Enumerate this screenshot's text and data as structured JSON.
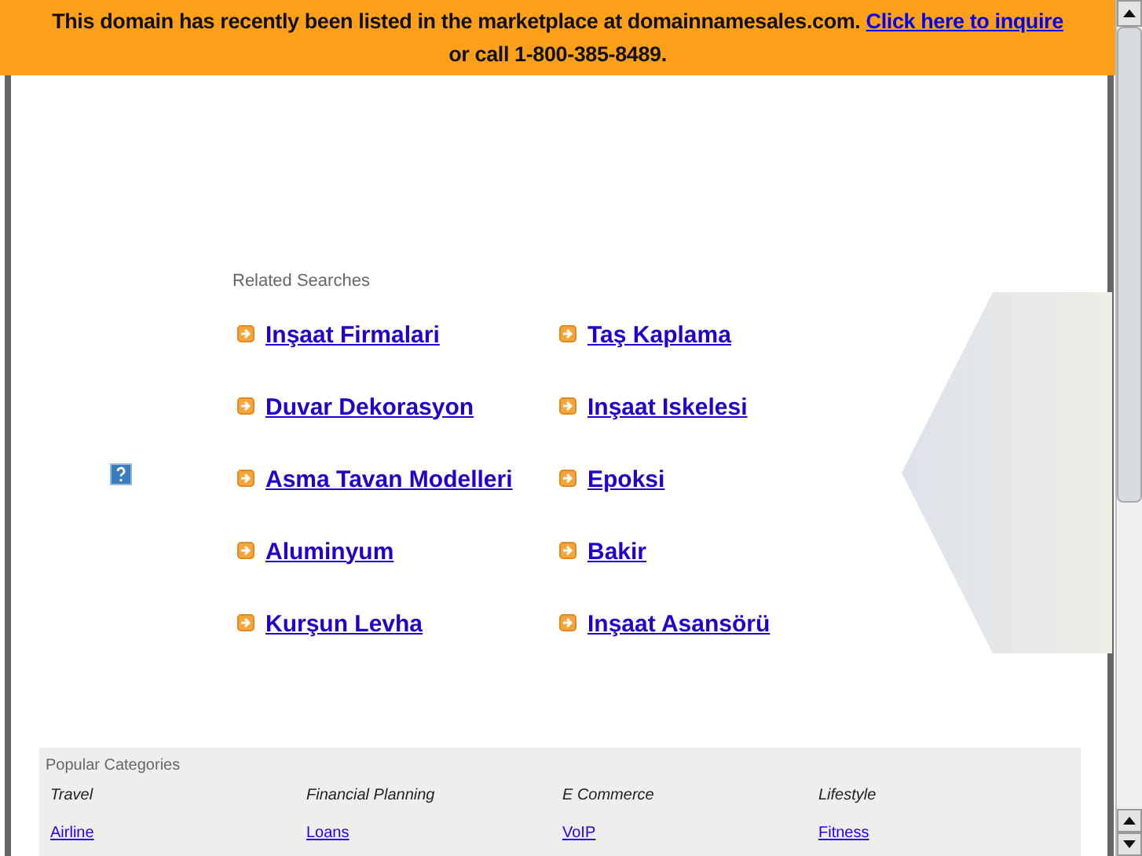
{
  "banner": {
    "message": "This domain has recently been listed in the marketplace at domainnamesales.com.",
    "link": "Click here to inquire",
    "phone": "or call 1-800-385-8489."
  },
  "related_searches": {
    "title": "Related Searches",
    "items": [
      {
        "label": "Inşaat Firmalari"
      },
      {
        "label": "Taş Kaplama"
      },
      {
        "label": "Duvar Dekorasyon"
      },
      {
        "label": "Inşaat Iskelesi"
      },
      {
        "label": "Asma Tavan Modelleri"
      },
      {
        "label": "Epoksi"
      },
      {
        "label": "Aluminyum"
      },
      {
        "label": "Bakir"
      },
      {
        "label": "Kurşun Levha"
      },
      {
        "label": "Inşaat Asansörü"
      }
    ]
  },
  "popular_categories": {
    "title": "Popular Categories",
    "columns": [
      {
        "heading": "Travel",
        "link": "Airline"
      },
      {
        "heading": "Financial Planning",
        "link": "Loans"
      },
      {
        "heading": "E Commerce",
        "link": "VoIP"
      },
      {
        "heading": "Lifestyle",
        "link": "Fitness"
      }
    ]
  }
}
